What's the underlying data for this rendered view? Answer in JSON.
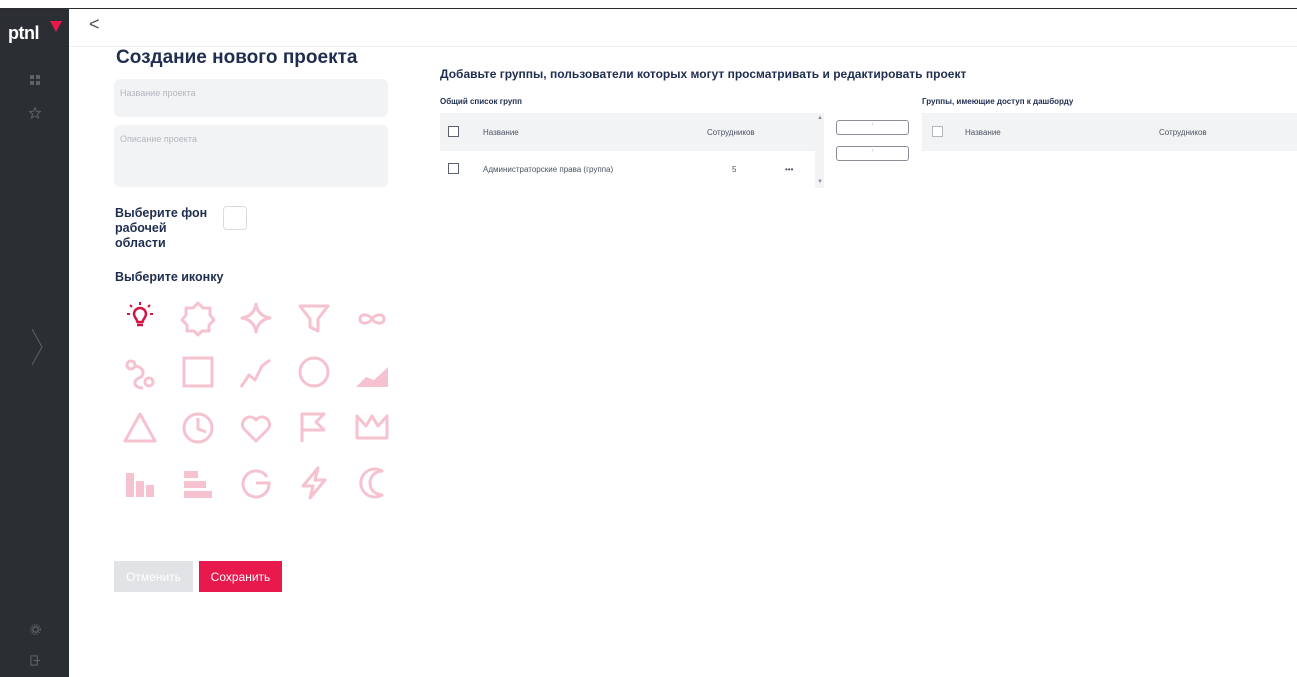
{
  "app": {
    "logo": "ptnl"
  },
  "sidebar": {
    "icons": [
      "dashboard-grid-icon",
      "star-icon",
      "chevron-right-icon",
      "gear-icon",
      "logout-icon"
    ]
  },
  "topbar": {
    "back_label": "<"
  },
  "form": {
    "title": "Создание нового проекта",
    "name_placeholder": "Название проекта",
    "description_placeholder": "Описание проекта",
    "background_label": "Выберите фон рабочей области",
    "icon_label": "Выберите иконку",
    "icons": [
      "lightbulb-icon",
      "badge-icon",
      "sparkle-icon",
      "funnel-icon",
      "infinity-icon",
      "path-icon",
      "square-icon",
      "trend-line-icon",
      "circle-icon",
      "area-chart-icon",
      "triangle-icon",
      "clock-icon",
      "heart-icon",
      "flag-icon",
      "crown-icon",
      "bar-chart-icon",
      "horizontal-bars-icon",
      "pie-chart-icon",
      "lightning-icon",
      "moon-icon"
    ],
    "selected_icon": "lightbulb-icon",
    "cancel_label": "Отменить",
    "save_label": "Сохранить"
  },
  "groups": {
    "title": "Добавьте группы, пользователи которых могут просматривать и редактировать проект",
    "all": {
      "title": "Общий список групп",
      "col_name": "Название",
      "col_count": "Сотрудников",
      "rows": [
        {
          "name": "Администраторские права (группа)",
          "count": "5",
          "menu": "•••"
        }
      ]
    },
    "access": {
      "title": "Группы, имеющие доступ к дашборду",
      "col_name": "Название",
      "col_count": "Сотрудников"
    },
    "move_right_label": "›",
    "move_left_label": "‹"
  },
  "colors": {
    "accent": "#e8194c",
    "sidebar": "#2b2f33",
    "icon_inactive": "#f6c2cf"
  }
}
